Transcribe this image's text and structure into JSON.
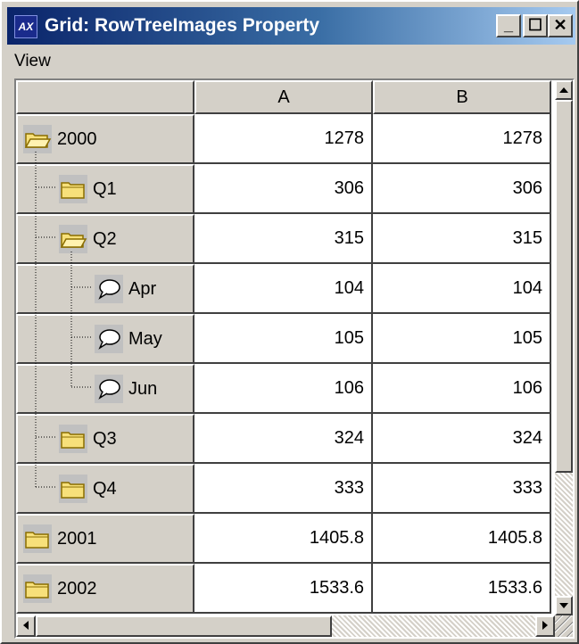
{
  "window": {
    "title": "Grid: RowTreeImages Property",
    "icon_name": "app-grid-icon",
    "controls": [
      "minimize-icon",
      "maximize-icon",
      "close-icon"
    ],
    "control_glyphs": {
      "minimize": "_",
      "maximize": "☐",
      "close": "✕"
    }
  },
  "menu": {
    "items": [
      {
        "label": "View"
      }
    ]
  },
  "grid": {
    "columns": [
      "A",
      "B"
    ],
    "rows": [
      {
        "label": "2000",
        "level": 0,
        "icon": "open-folder-icon",
        "a": "1278",
        "b": "1278"
      },
      {
        "label": "Q1",
        "level": 1,
        "icon": "closed-folder-icon",
        "a": "306",
        "b": "306"
      },
      {
        "label": "Q2",
        "level": 1,
        "icon": "open-folder-icon",
        "a": "315",
        "b": "315"
      },
      {
        "label": "Apr",
        "level": 2,
        "icon": "speech-bubble-icon",
        "a": "104",
        "b": "104"
      },
      {
        "label": "May",
        "level": 2,
        "icon": "speech-bubble-icon",
        "a": "105",
        "b": "105"
      },
      {
        "label": "Jun",
        "level": 2,
        "icon": "speech-bubble-icon",
        "a": "106",
        "b": "106"
      },
      {
        "label": "Q3",
        "level": 1,
        "icon": "closed-folder-icon",
        "a": "324",
        "b": "324"
      },
      {
        "label": "Q4",
        "level": 1,
        "icon": "closed-folder-icon",
        "a": "333",
        "b": "333"
      },
      {
        "label": "2001",
        "level": 0,
        "icon": "closed-folder-icon",
        "a": "1405.8",
        "b": "1405.8"
      },
      {
        "label": "2002",
        "level": 0,
        "icon": "closed-folder-icon",
        "a": "1533.6",
        "b": "1533.6"
      }
    ]
  },
  "colors": {
    "header_bg": "#d4d0c8",
    "folder_fill": "#f7e07a",
    "folder_stroke": "#8a6d00",
    "title_gradient_start": "#0a246a"
  }
}
